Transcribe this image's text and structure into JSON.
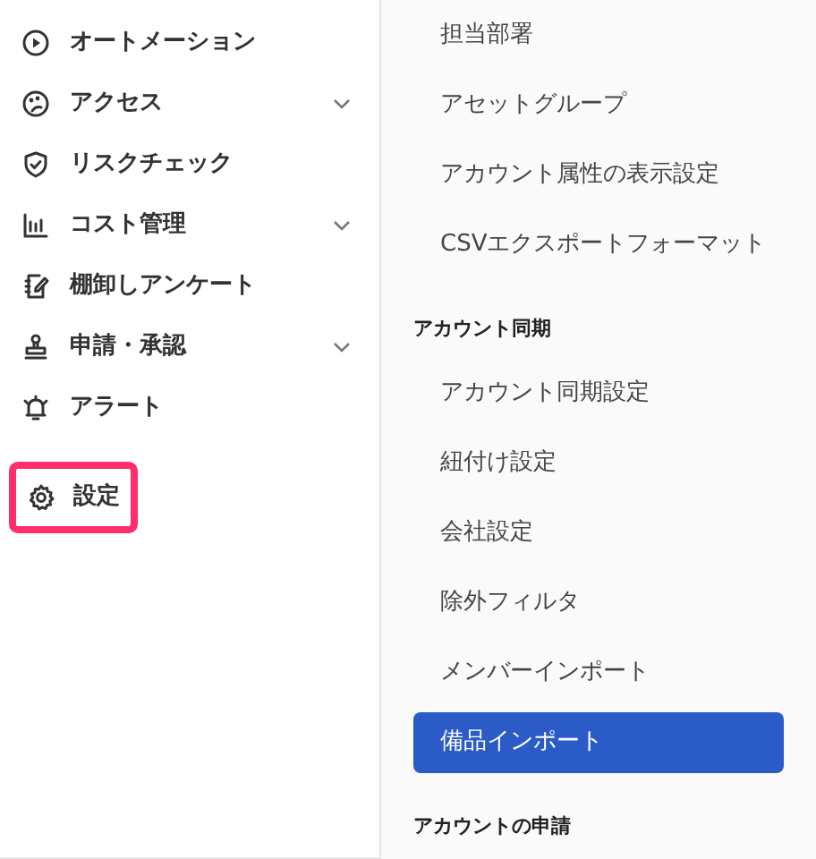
{
  "sidebar": {
    "items": [
      {
        "label": "オートメーション",
        "expandable": false,
        "highlighted": false
      },
      {
        "label": "アクセス",
        "expandable": true,
        "highlighted": false
      },
      {
        "label": "リスクチェック",
        "expandable": false,
        "highlighted": false
      },
      {
        "label": "コスト管理",
        "expandable": true,
        "highlighted": false
      },
      {
        "label": "棚卸しアンケート",
        "expandable": false,
        "highlighted": false
      },
      {
        "label": "申請・承認",
        "expandable": true,
        "highlighted": false
      },
      {
        "label": "アラート",
        "expandable": false,
        "highlighted": false
      },
      {
        "label": "設定",
        "expandable": false,
        "highlighted": true
      }
    ]
  },
  "settings_menu": [
    {
      "kind": "item",
      "label": "担当部署",
      "selected": false
    },
    {
      "kind": "item",
      "label": "アセットグループ",
      "selected": false
    },
    {
      "kind": "item",
      "label": "アカウント属性の表示設定",
      "selected": false
    },
    {
      "kind": "item",
      "label": "CSVエクスポートフォーマット",
      "selected": false
    },
    {
      "kind": "header",
      "label": "アカウント同期"
    },
    {
      "kind": "item",
      "label": "アカウント同期設定",
      "selected": false
    },
    {
      "kind": "item",
      "label": "紐付け設定",
      "selected": false
    },
    {
      "kind": "item",
      "label": "会社設定",
      "selected": false
    },
    {
      "kind": "item",
      "label": "除外フィルタ",
      "selected": false
    },
    {
      "kind": "item",
      "label": "メンバーインポート",
      "selected": false
    },
    {
      "kind": "item",
      "label": "備品インポート",
      "selected": true
    },
    {
      "kind": "header",
      "label": "アカウントの申請"
    }
  ]
}
